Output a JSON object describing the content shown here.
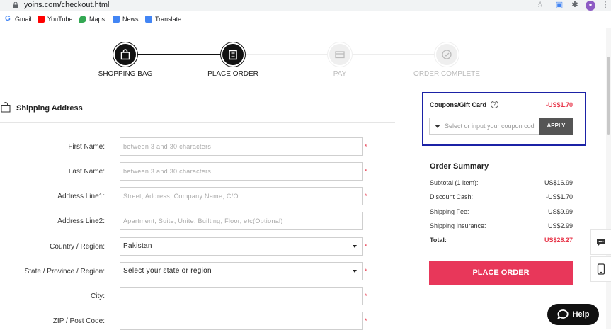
{
  "browser": {
    "url": "yoins.com/checkout.html",
    "bookmarks": [
      {
        "label": "Gmail",
        "icon": "gmail-icon",
        "color": "#4285f4"
      },
      {
        "label": "YouTube",
        "icon": "youtube-icon",
        "color": "#ff0000"
      },
      {
        "label": "Maps",
        "icon": "maps-icon",
        "color": "#34a853"
      },
      {
        "label": "News",
        "icon": "news-icon",
        "color": "#4285f4"
      },
      {
        "label": "Translate",
        "icon": "translate-icon",
        "color": "#4285f4"
      }
    ]
  },
  "steps": [
    {
      "label": "SHOPPING BAG",
      "icon": "shopping-bag-icon",
      "active": true
    },
    {
      "label": "PLACE ORDER",
      "icon": "clipboard-icon",
      "active": true
    },
    {
      "label": "PAY",
      "icon": "card-icon",
      "active": false
    },
    {
      "label": "ORDER COMPLETE",
      "icon": "check-circle-icon",
      "active": false
    }
  ],
  "shipping": {
    "title": "Shipping Address",
    "fields": [
      {
        "label": "First Name:",
        "placeholder": "between 3 and 30 characters",
        "value": "",
        "required": true
      },
      {
        "label": "Last Name:",
        "placeholder": "between 3 and 30 characters",
        "value": "",
        "required": true
      },
      {
        "label": "Address Line1:",
        "placeholder": "Street, Address, Company Name, C/O",
        "value": "",
        "required": true
      },
      {
        "label": "Address Line2:",
        "placeholder": "Apartment, Suite, Unite, Builting, Floor, etc(Optional)",
        "value": "",
        "required": false
      },
      {
        "label": "Country / Region:",
        "value": "Pakistan",
        "select": true,
        "required": true
      },
      {
        "label": "State / Province / Region:",
        "value": "Select your state or region",
        "select": true,
        "required": true
      },
      {
        "label": "City:",
        "placeholder": "",
        "value": "",
        "required": true
      },
      {
        "label": "ZIP / Post Code:",
        "placeholder": "",
        "value": "",
        "required": true
      }
    ]
  },
  "coupon": {
    "title": "Coupons/Gift Card",
    "help": "?",
    "amount": "-US$1.70",
    "placeholder": "Select or input your coupon cod",
    "apply_label": "APPLY"
  },
  "order_summary": {
    "title": "Order Summary",
    "rows": [
      {
        "label": "Subtotal (1 item):",
        "value": "US$16.99"
      },
      {
        "label": "Discount Cash:",
        "value": "-US$1.70"
      },
      {
        "label": "Shipping Fee:",
        "value": "US$9.99"
      },
      {
        "label": "Shipping Insurance:",
        "value": "US$2.99"
      },
      {
        "label": "Total:",
        "value": "US$28.27"
      }
    ],
    "place_order_label": "PLACE ORDER"
  },
  "help": {
    "label": "Help"
  },
  "colors": {
    "accent": "#e8375a",
    "coupon_border": "#1b22a6",
    "price": "#e8374b"
  }
}
